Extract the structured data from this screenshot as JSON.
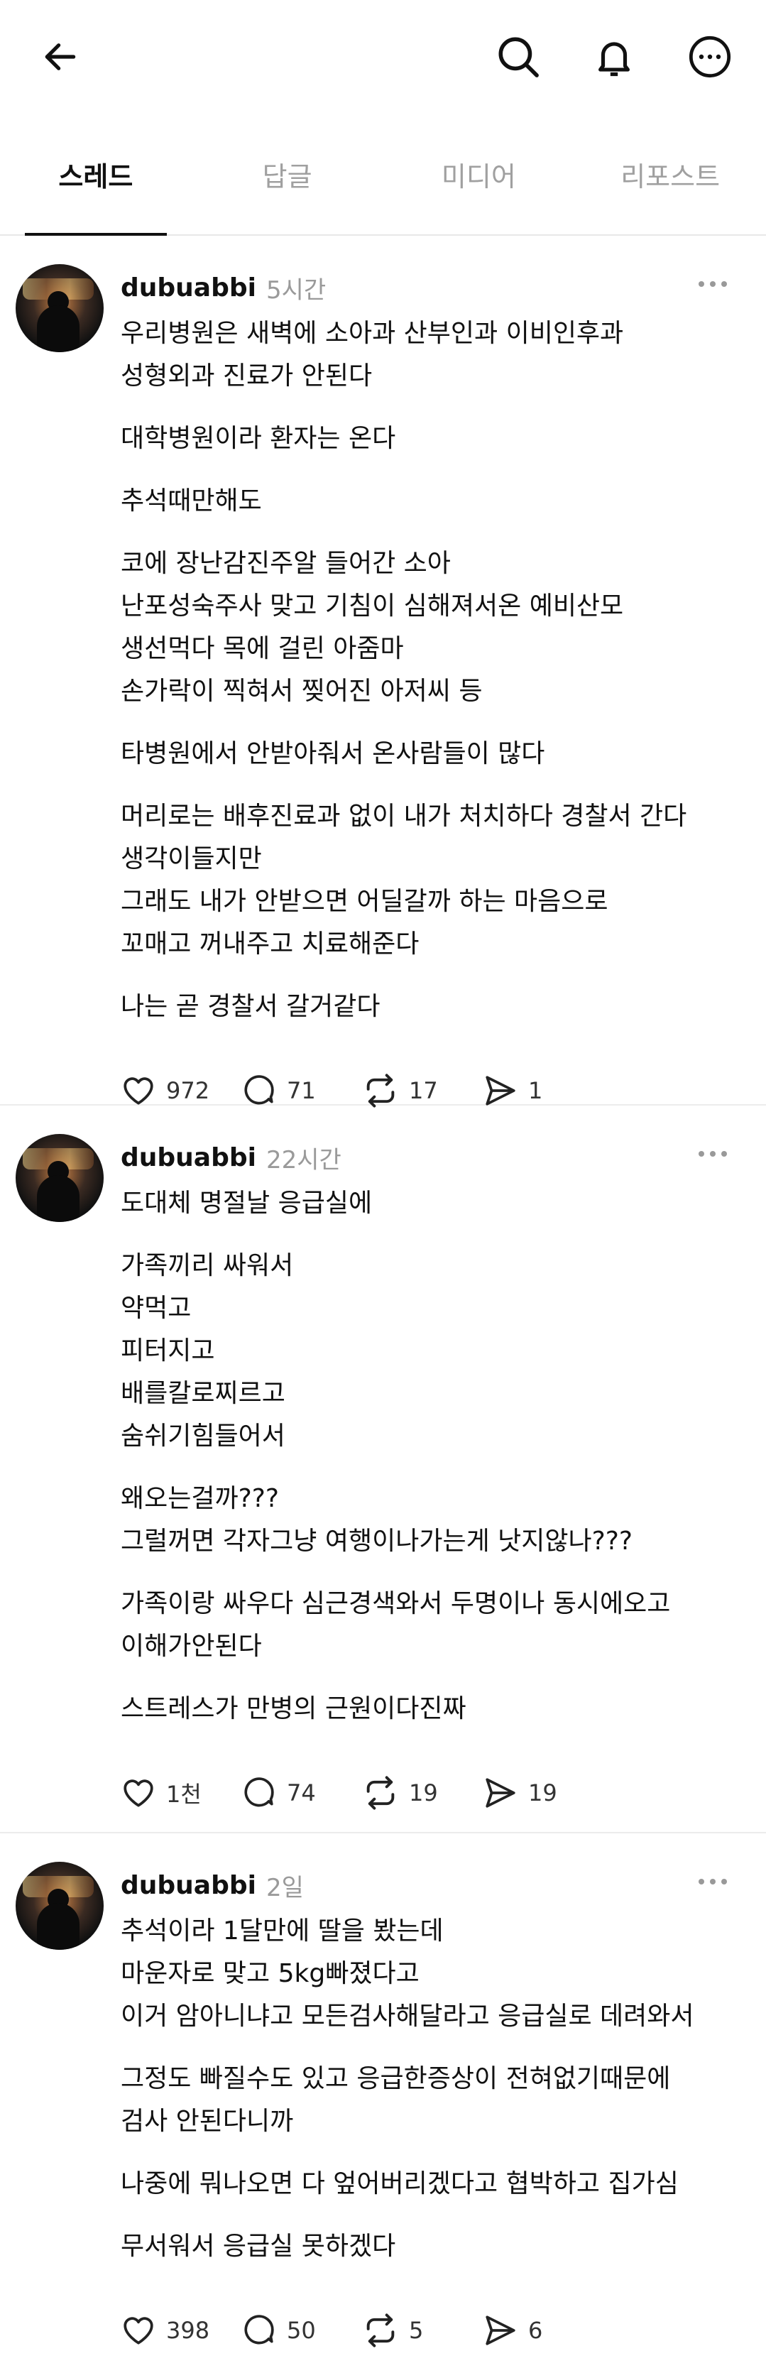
{
  "tabs": [
    {
      "label": "스레드",
      "active": true
    },
    {
      "label": "답글",
      "active": false
    },
    {
      "label": "미디어",
      "active": false
    },
    {
      "label": "리포스트",
      "active": false
    }
  ],
  "posts": [
    {
      "username": "dubuabbi",
      "time": "5시간",
      "paragraphs": [
        "우리병원은 새벽에 소아과 산부인과 이비인후과\n성형외과 진료가 안된다",
        "대학병원이라 환자는 온다",
        "추석때만해도",
        "코에 장난감진주알 들어간 소아\n난포성숙주사 맞고 기침이 심해져서온 예비산모\n생선먹다 목에 걸린 아줌마\n손가락이 찍혀서 찢어진 아저씨 등",
        "타병원에서 안받아줘서 온사람들이 많다",
        "머리로는  배후진료과 없이 내가 처치하다 경찰서 간다\n생각이들지만\n그래도 내가 안받으면 어딜갈까 하는 마음으로\n꼬매고 꺼내주고 치료해준다",
        "나는 곧 경찰서 갈거같다"
      ],
      "likes": "972",
      "replies": "71",
      "reposts": "17",
      "shares": "1"
    },
    {
      "username": "dubuabbi",
      "time": "22시간",
      "paragraphs": [
        "도대체 명절날 응급실에",
        "가족끼리 싸워서\n약먹고\n피터지고\n배를칼로찌르고\n숨쉬기힘들어서",
        "왜오는걸까???\n그럴꺼면 각자그냥 여행이나가는게 낫지않나???",
        "가족이랑 싸우다 심근경색와서 두명이나 동시에오고\n이해가안된다",
        "스트레스가 만병의 근원이다진짜"
      ],
      "likes": "1천",
      "replies": "74",
      "reposts": "19",
      "shares": "19"
    },
    {
      "username": "dubuabbi",
      "time": "2일",
      "paragraphs": [
        "추석이라 1달만에 딸을 봤는데\n마운자로 맞고 5kg빠졌다고\n이거 암아니냐고 모든검사해달라고 응급실로 데려와서",
        "그정도 빠질수도 있고 응급한증상이 전혀없기때문에\n검사 안된다니까",
        "나중에 뭐나오면 다 엎어버리겠다고 협박하고 집가심",
        "무서워서 응급실 못하겠다"
      ],
      "likes": "398",
      "replies": "50",
      "reposts": "5",
      "shares": "6"
    }
  ]
}
